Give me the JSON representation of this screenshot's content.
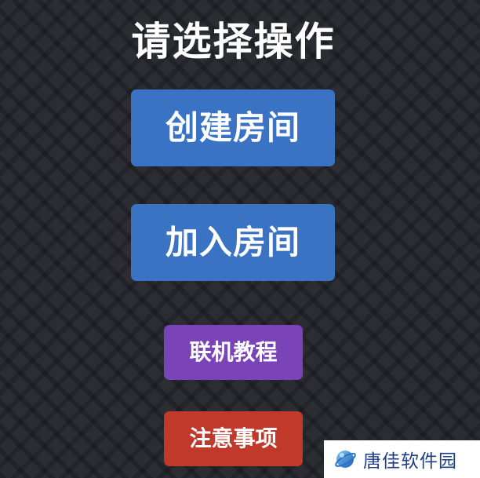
{
  "title": "请选择操作",
  "buttons": {
    "create_room": "创建房间",
    "join_room": "加入房间",
    "tutorial": "联机教程",
    "notice": "注意事项"
  },
  "colors": {
    "background": "#2b2d33",
    "primary_button": "#3a72c4",
    "tutorial_button": "#7a44b8",
    "notice_button": "#c0392b",
    "watermark_text": "#1c3e8c"
  },
  "watermark": {
    "text": "唐佳软件园",
    "icon": "planet-logo-icon"
  }
}
